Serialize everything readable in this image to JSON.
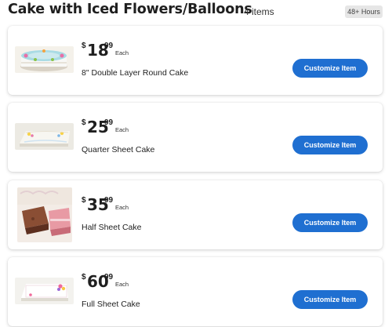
{
  "header": {
    "title": "Cake with Iced Flowers/Balloons",
    "item_count": "4 items",
    "badge": "48+ Hours"
  },
  "items": [
    {
      "currency": "$",
      "dollars": "18",
      "cents": "99",
      "unit": "Each",
      "name": "8\" Double Layer Round Cake",
      "button_label": "Customize Item"
    },
    {
      "currency": "$",
      "dollars": "25",
      "cents": "99",
      "unit": "Each",
      "name": "Quarter Sheet Cake",
      "button_label": "Customize Item"
    },
    {
      "currency": "$",
      "dollars": "35",
      "cents": "99",
      "unit": "Each",
      "name": "Half Sheet Cake",
      "button_label": "Customize Item"
    },
    {
      "currency": "$",
      "dollars": "60",
      "cents": "99",
      "unit": "Each",
      "name": "Full Sheet Cake",
      "button_label": "Customize Item"
    }
  ],
  "colors": {
    "button": "#1f6fd1",
    "badge_bg": "#e6e6e6"
  }
}
